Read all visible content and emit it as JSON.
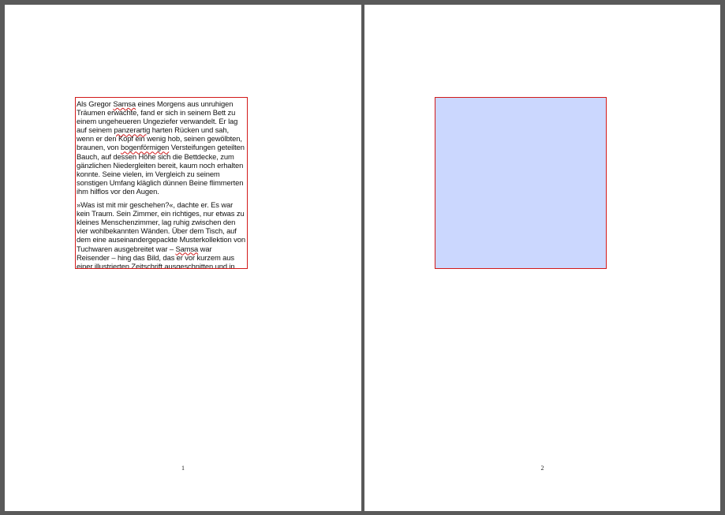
{
  "document": {
    "pages": [
      {
        "number": "1",
        "paragraphs": [
          {
            "segments": [
              {
                "text": "Als Gregor ",
                "spell": false
              },
              {
                "text": "Samsa",
                "spell": true
              },
              {
                "text": " eines Morgens aus unruhigen Träumen erwachte, fand er sich in seinem Bett zu einem ungeheueren Ungeziefer verwandelt. Er lag auf seinem ",
                "spell": false
              },
              {
                "text": "panzerartig",
                "spell": true
              },
              {
                "text": " harten Rücken und sah, wenn er den Kopf ein wenig hob, seinen gewölbten, braunen, von ",
                "spell": false
              },
              {
                "text": "bogenförmigen",
                "spell": true
              },
              {
                "text": " Versteifungen geteilten Bauch, auf dessen Höhe sich die Bettdecke, zum gänzlichen Niedergleiten bereit, kaum noch erhalten konnte. Seine vielen, im Vergleich zu seinem sonstigen Umfang kläglich dünnen Beine flimmerten ihm hilflos vor den Augen.",
                "spell": false
              }
            ]
          },
          {
            "segments": [
              {
                "text": "»Was ist mit mir geschehen?«, dachte er. Es war kein Traum. Sein Zimmer, ein richtiges, nur etwas zu kleines Menschenzimmer, lag ruhig zwischen den vier wohlbekannten Wänden. Über dem Tisch, auf dem eine auseinandergepackte Musterkollektion von Tuchwaren ausgebreitet war – ",
                "spell": false
              },
              {
                "text": "Samsa",
                "spell": true
              },
              {
                "text": " war Reisender – hing das Bild, das er vor kurzem aus einer illustrierten Zeitschrift ausgeschnitten und in",
                "spell": false
              }
            ]
          }
        ]
      },
      {
        "number": "2",
        "shape_fill": "#cbd7fe"
      }
    ],
    "frame_border_color": "#d21a1a",
    "background_color": "#5a5a5a"
  }
}
